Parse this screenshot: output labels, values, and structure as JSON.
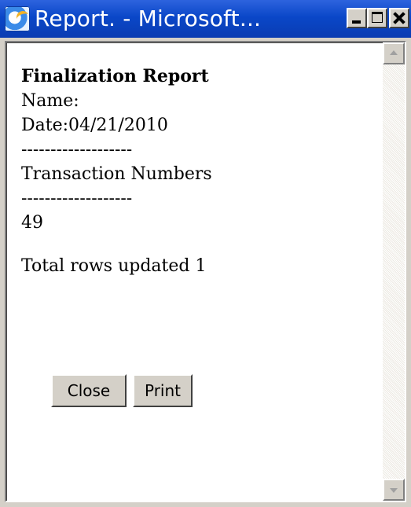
{
  "window": {
    "title": "Report. - Microsoft...",
    "colors": {
      "titlebar": "#0a47c8",
      "face": "#d4d0c8"
    }
  },
  "report": {
    "title": "Finalization Report",
    "name_line": "Name:",
    "date_line": "Date:04/21/2010",
    "separator_1": "-------------------",
    "section_header": "Transaction Numbers",
    "separator_2": "-------------------",
    "transaction_numbers": [
      "49"
    ],
    "summary": "Total rows updated 1"
  },
  "buttons": {
    "close_label": "Close",
    "print_label": "Print"
  },
  "icons": {
    "app_icon": "internet-explorer-icon",
    "minimize": "minimize-icon",
    "maximize": "maximize-icon",
    "close": "close-icon",
    "scroll_up": "scroll-up-arrow-icon",
    "scroll_down": "scroll-down-arrow-icon"
  }
}
